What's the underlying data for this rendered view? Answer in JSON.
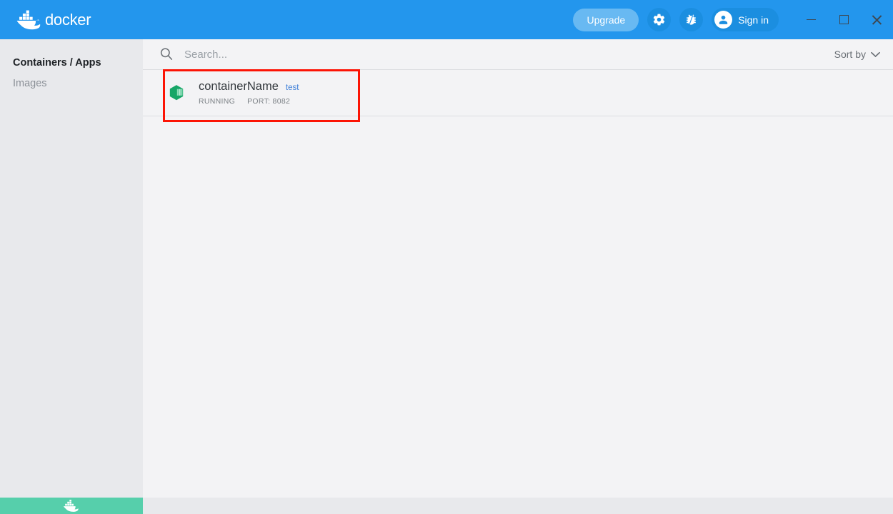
{
  "titlebar": {
    "brand_label": "docker",
    "brand_icon": "docker-whale-logo",
    "upgrade_label": "Upgrade",
    "settings_icon": "gear-icon",
    "bug_icon": "bug-icon",
    "signin_label": "Sign in",
    "signin_icon": "user-circle-icon",
    "minimize_icon": "minimize-icon",
    "maximize_icon": "maximize-icon",
    "close_icon": "close-icon",
    "background_color": "#2396ed",
    "upgrade_color": "#68b9f2"
  },
  "sidebar": {
    "items": [
      {
        "label": "Containers / Apps",
        "active": true
      },
      {
        "label": "Images",
        "active": false
      }
    ],
    "background_color": "#e8e9ec"
  },
  "statusbar": {
    "icon": "docker-whale-icon",
    "color": "#56cfab"
  },
  "search": {
    "icon": "search-icon",
    "placeholder": "Search...",
    "value": ""
  },
  "sort": {
    "label": "Sort by",
    "icon": "chevron-down-icon"
  },
  "containers": {
    "columns": [
      "name",
      "tag",
      "status",
      "port"
    ],
    "rows": [
      {
        "icon": "container-box-icon",
        "name": "containerName",
        "tag": "test",
        "status": "RUNNING",
        "port": "PORT: 8082",
        "highlighted": true
      }
    ]
  },
  "highlight": {
    "color": "#fc1405"
  }
}
